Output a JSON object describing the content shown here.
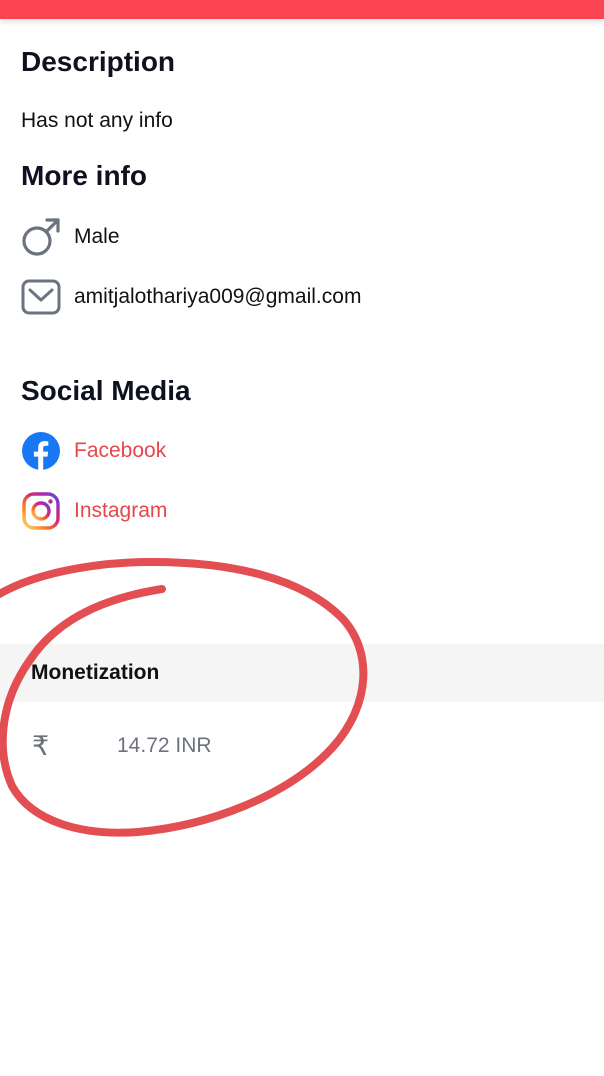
{
  "theme": {
    "accent": "#fa4450",
    "link_color": "#e5474b",
    "annotation_color": "#e04448"
  },
  "description": {
    "heading": "Description",
    "text": "Has not any info"
  },
  "more_info": {
    "heading": "More info",
    "gender": {
      "icon": "male-icon",
      "value": "Male"
    },
    "email": {
      "icon": "mail-icon",
      "value": "amitjalothariya009@gmail.com"
    }
  },
  "social_media": {
    "heading": "Social Media",
    "links": [
      {
        "icon": "facebook-icon",
        "label": "Facebook"
      },
      {
        "icon": "instagram-icon",
        "label": "Instagram"
      }
    ]
  },
  "monetization": {
    "heading": "Monetization",
    "currency_icon": "rupee-icon",
    "currency_symbol": "₹",
    "amount": "14.72 INR"
  }
}
